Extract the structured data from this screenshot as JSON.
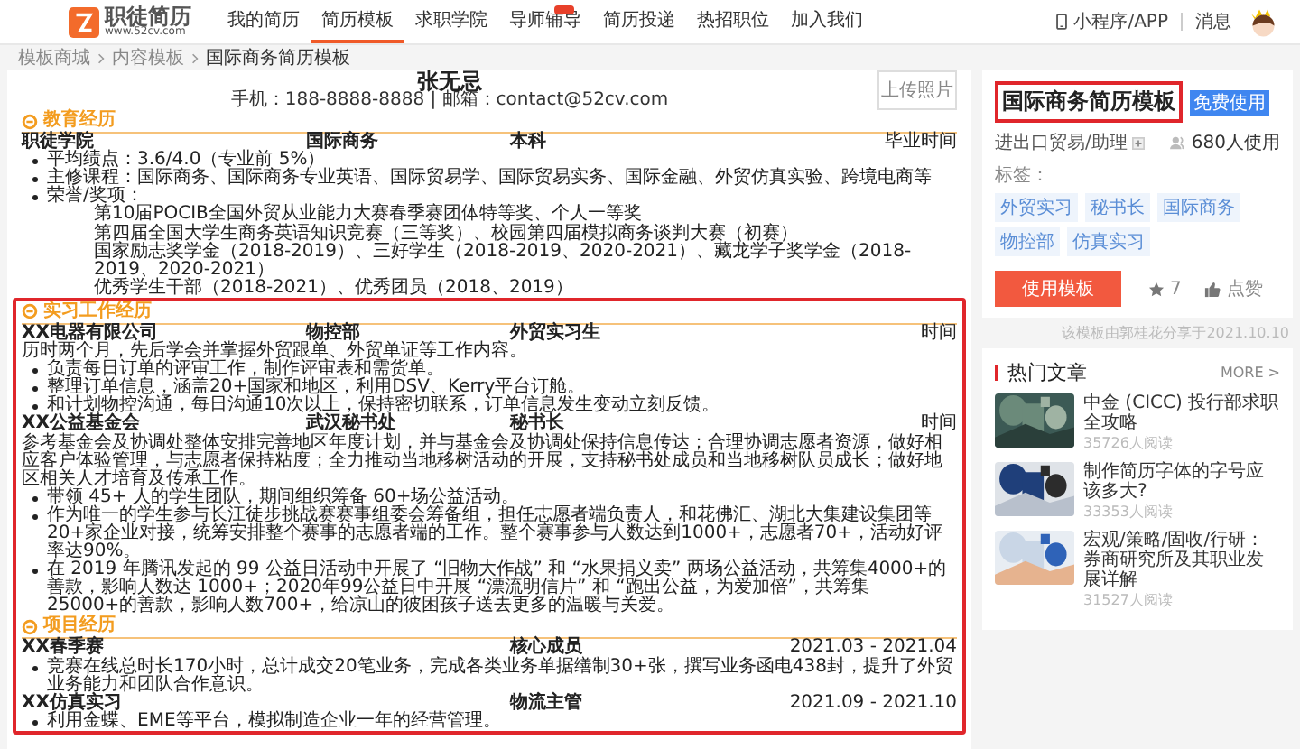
{
  "nav": {
    "logo": "职徒简历",
    "logo_url": "www.52cv.com",
    "items": [
      {
        "label": "我的简历",
        "selected": false,
        "badge": false
      },
      {
        "label": "简历模板",
        "selected": true,
        "badge": false
      },
      {
        "label": "求职学院",
        "selected": false,
        "badge": false
      },
      {
        "label": "导师辅导",
        "selected": false,
        "badge": true
      },
      {
        "label": "简历投递",
        "selected": false,
        "badge": false
      },
      {
        "label": "热招职位",
        "selected": false,
        "badge": false
      },
      {
        "label": "加入我们",
        "selected": false,
        "badge": false
      }
    ],
    "app": "小程序/APP",
    "messages": "消息"
  },
  "breadcrumb": [
    "模板商城",
    "内容模板",
    "国际商务简历模板"
  ],
  "resume": {
    "name": "张无忌",
    "contact": "手机：188-8888-8888 | 邮箱：contact@52cv.com",
    "photo": "上传照片",
    "sections": [
      {
        "title": "教育经历",
        "highlighted": false,
        "entries": [
          {
            "org": "职徒学院",
            "dept": "国际商务",
            "role": "本科",
            "time": "毕业时间",
            "bullets": [
              {
                "text": "平均绩点：3.6/4.0（专业前 5%）"
              },
              {
                "text": "主修课程：国际商务、国际商务专业英语、国际贸易学、国际贸易实务、国际金融、外贸仿真实验、跨境电商等"
              },
              {
                "text": "荣誉/奖项：",
                "sub": [
                  "第10届POCIB全国外贸从业能力大赛春季赛团体特等奖、个人一等奖",
                  "第四届全国大学生商务英语知识竞赛（三等奖）、校园第四届模拟商务谈判大赛（初赛）",
                  "国家励志奖学金（2018-2019）、三好学生（2018-2019、2020-2021）、藏龙学子奖学金（2018-2019、2020-2021）",
                  "优秀学生干部（2018-2021）、优秀团员（2018、2019）"
                ]
              }
            ]
          }
        ]
      },
      {
        "title": "实习工作经历",
        "highlighted": true,
        "entries": [
          {
            "org": "XX电器有限公司",
            "dept": "物控部",
            "role": "外贸实习生",
            "time": "时间",
            "desc": "历时两个月，先后学会并掌握外贸跟单、外贸单证等工作内容。",
            "bullets": [
              {
                "text": "负责每日订单的评审工作，制作评审表和需货单。"
              },
              {
                "text": "整理订单信息，涵盖20+国家和地区，利用DSV、Kerry平台订舱。"
              },
              {
                "text": "和计划物控沟通，每日沟通10次以上，保持密切联系，订单信息发生变动立刻反馈。"
              }
            ]
          },
          {
            "org": "XX公益基金会",
            "dept": "武汉秘书处",
            "role": "秘书长",
            "time": "时间",
            "desc": "参考基金会及协调处整体安排完善地区年度计划，并与基金会及协调处保持信息传达；合理协调志愿者资源，做好相应客户体验管理，与志愿者保持粘度；全力推动当地移树活动的开展，支持秘书处成员和当地移树队员成长；做好地区相关人才培育及传承工作。",
            "bullets": [
              {
                "text": "带领 45+ 人的学生团队，期间组织筹备 60+场公益活动。"
              },
              {
                "text": "作为唯一的学生参与长江徒步挑战赛赛事组委会筹备组，担任志愿者端负责人，和花佛汇、湖北大集建设集团等20+家企业对接，统筹安排整个赛事的志愿者端的工作。整个赛事参与人数达到1000+，志愿者70+，活动好评率达90%。"
              },
              {
                "text": "在 2019 年腾讯发起的 99 公益日活动中开展了 “旧物大作战” 和 “水果捐义卖” 两场公益活动，共筹集4000+的善款，影响人数达 1000+；2020年99公益日中开展 “漂流明信片” 和 “跑出公益，为爱加倍”，共筹集25000+的善款，影响人数700+，给凉山的彼困孩子送去更多的温暖与关爱。"
              }
            ]
          }
        ]
      },
      {
        "title": "项目经历",
        "highlighted": true,
        "entries": [
          {
            "org": "XX春季赛",
            "role": "核心成员",
            "time": "2021.03 - 2021.04",
            "bullets": [
              {
                "text": "竞赛在线总时长170小时，总计成交20笔业务，完成各类业务单据缮制30+张，撰写业务函电438封，提升了外贸业务能力和团队合作意识。"
              }
            ]
          },
          {
            "org": "XX仿真实习",
            "role": "物流主管",
            "time": "2021.09 - 2021.10",
            "bullets": [
              {
                "text": "利用金蝶、EME等平台，模拟制造企业一年的经营管理。"
              }
            ]
          }
        ]
      }
    ]
  },
  "template": {
    "title": "国际商务简历模板",
    "highlighted": true,
    "badge": "免费使用",
    "category": "进出口贸易/助理",
    "users": "680人使用",
    "tags_label": "标签：",
    "tags": [
      "外贸实习",
      "秘书长",
      "国际商务",
      "物控部",
      "仿真实习"
    ],
    "use_button": "使用模板",
    "stars": "7",
    "like": "点赞",
    "shared": "该模板由郭桂花分享于2021.10.10"
  },
  "hot_articles": {
    "title": "热门文章",
    "more": "MORE >",
    "items": [
      {
        "title": "中金 (CICC) 投行部求职全攻略",
        "reads": "35726人阅读"
      },
      {
        "title": "制作简历字体的字号应该多大?",
        "reads": "33353人阅读"
      },
      {
        "title": "宏观/策略/固收/行研：券商研究所及其职业发展详解",
        "reads": "31527人阅读"
      }
    ]
  }
}
